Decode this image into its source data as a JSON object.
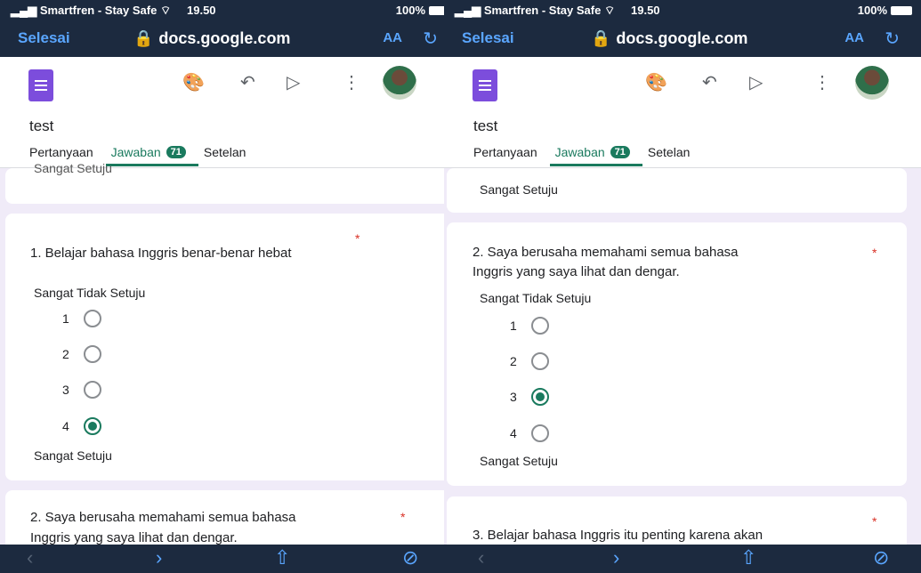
{
  "status": {
    "carrier": "Smartfren - Stay Safe",
    "time": "19.50",
    "battery": "100%"
  },
  "browser": {
    "done": "Selesai",
    "url": "docs.google.com",
    "text_size": "AA"
  },
  "form": {
    "title": "test",
    "tabs": {
      "questions": "Pertanyaan",
      "responses": "Jawaban",
      "responses_count": "71",
      "settings": "Setelan"
    }
  },
  "left": {
    "clipped_text": "Sangat Setuju",
    "q1": {
      "text": "1. Belajar bahasa Inggris benar-benar hebat",
      "required_mark": "*",
      "low_label": "Sangat Tidak Setuju",
      "high_label": "Sangat Setuju",
      "options": [
        "1",
        "2",
        "3",
        "4"
      ],
      "selected": "4"
    },
    "q2": {
      "line1": "2. Saya berusaha memahami semua bahasa",
      "line2": "Inggris yang saya lihat dan dengar.",
      "required_mark": "*"
    }
  },
  "right": {
    "prev_high_label": "Sangat Setuju",
    "q2": {
      "line1": "2. Saya berusaha memahami semua bahasa",
      "line2": "Inggris yang saya lihat dan dengar.",
      "required_mark": "*",
      "low_label": "Sangat Tidak Setuju",
      "high_label": "Sangat Setuju",
      "options": [
        "1",
        "2",
        "3",
        "4"
      ],
      "selected": "3"
    },
    "q3": {
      "text": "3. Belajar bahasa Inggris itu penting karena akan",
      "required_mark": "*"
    }
  },
  "icons": {
    "lock": "lock-icon",
    "palette": "palette-icon",
    "undo": "undo-icon",
    "send": "send-icon",
    "more": "more-vert-icon",
    "back": "chevron-left-icon",
    "forward": "chevron-right-icon",
    "share": "share-icon",
    "compass": "compass-icon"
  },
  "colors": {
    "accent": "#1a7a5e",
    "required": "#d93025",
    "browser_bar": "#1c2a3f",
    "link": "#5aa6ff",
    "form_icon": "#7c4ddc"
  }
}
